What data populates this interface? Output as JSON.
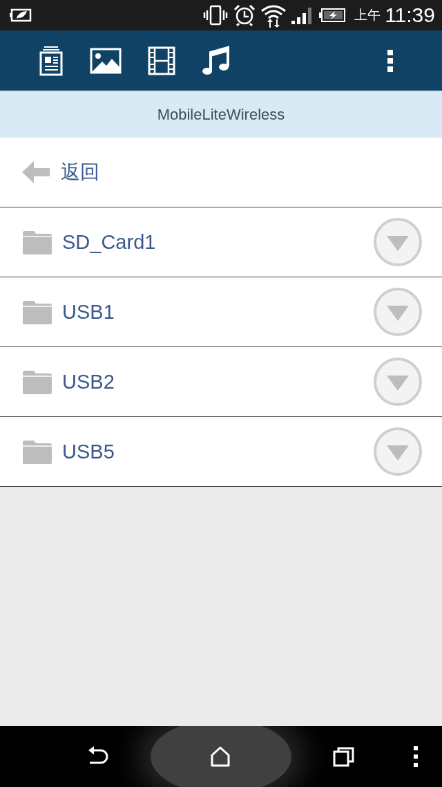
{
  "status_bar": {
    "meridiem": "上午",
    "time": "11:39"
  },
  "toolbar": {
    "tabs": [
      {
        "kind": "document"
      },
      {
        "kind": "image"
      },
      {
        "kind": "video"
      },
      {
        "kind": "music"
      }
    ]
  },
  "header": {
    "title": "MobileLiteWireless"
  },
  "back": {
    "label": "返回"
  },
  "folders": [
    {
      "name": "SD_Card1"
    },
    {
      "name": "USB1"
    },
    {
      "name": "USB2"
    },
    {
      "name": "USB5"
    }
  ]
}
